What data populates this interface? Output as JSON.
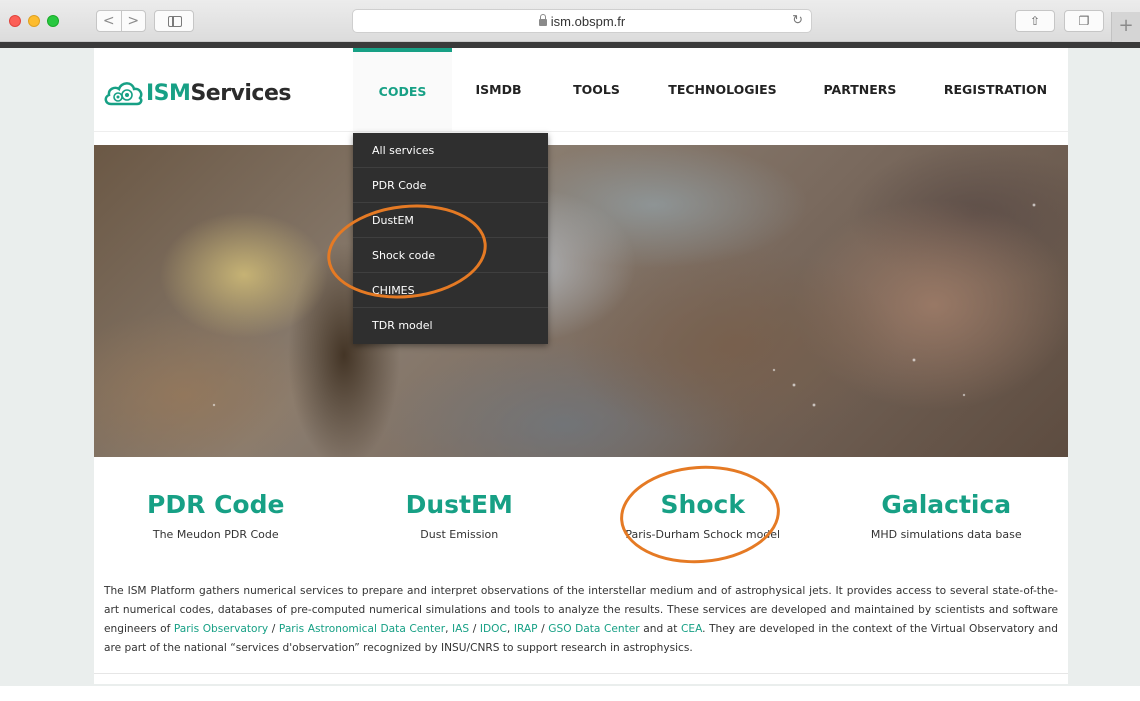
{
  "browser": {
    "url": "ism.obspm.fr",
    "back_glyph": "<",
    "forward_glyph": ">",
    "reload_glyph": "↻",
    "share_glyph": "⇧",
    "tabs_glyph": "❐",
    "newtab_glyph": "+"
  },
  "logo": {
    "part1": "ISM",
    "part2": "Services"
  },
  "nav": {
    "items": [
      {
        "label": "CODES",
        "active": true
      },
      {
        "label": "ISMDB"
      },
      {
        "label": "TOOLS"
      },
      {
        "label": "TECHNOLOGIES"
      },
      {
        "label": "PARTNERS"
      },
      {
        "label": "REGISTRATION"
      }
    ]
  },
  "dropdown": {
    "items": [
      "All services",
      "PDR Code",
      "DustEM",
      "Shock code",
      "CHIMES",
      "TDR model"
    ]
  },
  "features": [
    {
      "title": "PDR Code",
      "subtitle": "The Meudon PDR Code"
    },
    {
      "title": "DustEM",
      "subtitle": "Dust Emission"
    },
    {
      "title": "Shock",
      "subtitle": "Paris-Durham Schock model"
    },
    {
      "title": "Galactica",
      "subtitle": "MHD simulations data base"
    }
  ],
  "description": {
    "t1": "The ISM Platform gathers numerical services to prepare and interpret observations of the interstellar medium and of astrophysical jets. It provides access to several state-of-the-art numerical codes, databases of pre-computed numerical simulations and tools to analyze the results. These services are developed and maintained by scientists and software engineers of ",
    "l1": "Paris Observatory",
    "t2": " / ",
    "l2": "Paris Astronomical Data Center",
    "t3": ", ",
    "l3": "IAS",
    "t4": " / ",
    "l4": "IDOC",
    "t5": ", ",
    "l5": "IRAP",
    "t6": " / ",
    "l6": "GSO Data Center",
    "t7": " and at ",
    "l7": "CEA",
    "t8": ". They are developed in the context of the Virtual Observatory and are part of the national “services d'observation” recognized by INSU/CNRS to support research in astrophysics."
  },
  "colors": {
    "accent": "#17a085",
    "annotation": "#e57a24",
    "dropdown_bg": "#2f2f2f"
  }
}
